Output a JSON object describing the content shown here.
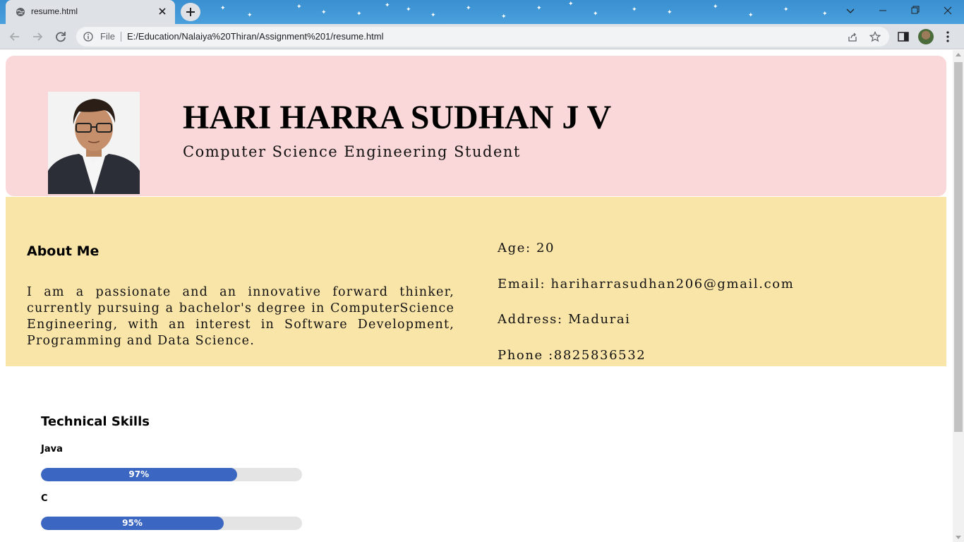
{
  "browser": {
    "tab_title": "resume.html",
    "omnibox_scheme": "File",
    "url": "E:/Education/Nalaiya%20Thiran/Assignment%201/resume.html"
  },
  "header": {
    "name": "HARI HARRA SUDHAN J V",
    "role": "Computer Science Engineering Student"
  },
  "about": {
    "title": "About Me",
    "text": "I am a passionate and an innovative forward thinker, currently pursuing a bachelor's degree in ComputerScience Engineering, with an interest in Software Development, Programming and Data Science."
  },
  "contact": {
    "age": "Age: 20",
    "email": "Email: hariharrasudhan206@gmail.com",
    "address": "Address: Madurai",
    "phone": "Phone :8825836532"
  },
  "skills": {
    "title": "Technical Skills",
    "items": [
      {
        "name": "Java",
        "label": "97%",
        "fill_fraction": 0.75
      },
      {
        "name": "C",
        "label": "95%",
        "fill_fraction": 0.7
      }
    ]
  },
  "colors": {
    "header_bg": "#fad7d8",
    "about_bg": "#fae5a9",
    "bar_fill": "#3b66c1",
    "bar_track": "#e4e4e4"
  }
}
